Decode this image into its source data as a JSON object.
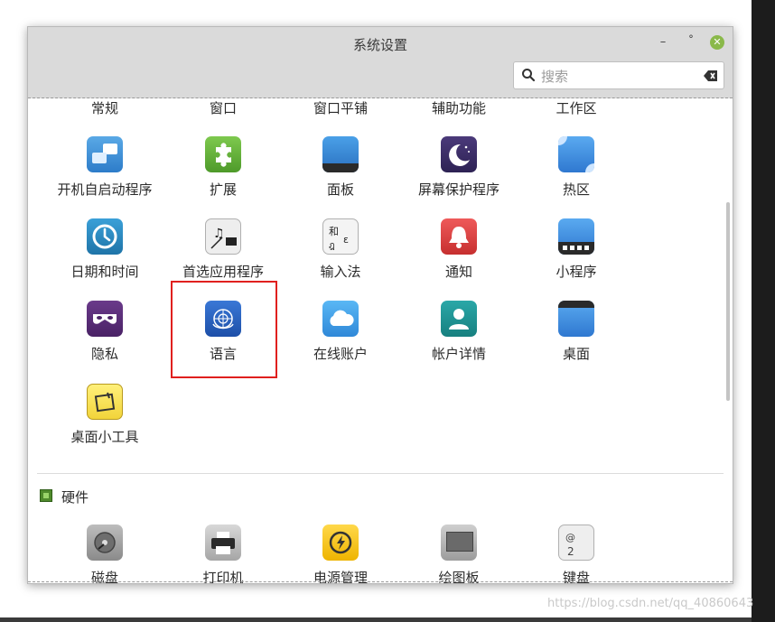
{
  "window": {
    "title": "系统设置",
    "controls": {
      "minimize": "–",
      "maximize": "˚",
      "close": "✕"
    }
  },
  "search": {
    "placeholder": "搜索",
    "value": ""
  },
  "top_row_labels": [
    "常规",
    "窗口",
    "窗口平铺",
    "辅助功能",
    "工作区"
  ],
  "preferences": {
    "row1": [
      {
        "label": "开机自启动程序",
        "icon": "startup-apps-icon"
      },
      {
        "label": "扩展",
        "icon": "extensions-puzzle-icon"
      },
      {
        "label": "面板",
        "icon": "panel-icon"
      },
      {
        "label": "屏幕保护程序",
        "icon": "screensaver-moon-icon"
      },
      {
        "label": "热区",
        "icon": "hot-corners-icon"
      }
    ],
    "row2": [
      {
        "label": "日期和时间",
        "icon": "clock-icon"
      },
      {
        "label": "首选应用程序",
        "icon": "preferred-apps-icon"
      },
      {
        "label": "输入法",
        "icon": "input-method-icon"
      },
      {
        "label": "通知",
        "icon": "notification-bell-icon"
      },
      {
        "label": "小程序",
        "icon": "applets-icon"
      }
    ],
    "row3": [
      {
        "label": "隐私",
        "icon": "privacy-mask-icon"
      },
      {
        "label": "语言",
        "icon": "language-globe-icon"
      },
      {
        "label": "在线账户",
        "icon": "online-accounts-cloud-icon"
      },
      {
        "label": "帐户详情",
        "icon": "account-details-user-icon"
      },
      {
        "label": "桌面",
        "icon": "desktop-icon"
      }
    ],
    "row4": [
      {
        "label": "桌面小工具",
        "icon": "desklets-note-icon"
      }
    ]
  },
  "hardware": {
    "heading": "硬件",
    "items": [
      {
        "label": "磁盘",
        "icon": "disks-icon"
      },
      {
        "label": "打印机",
        "icon": "printer-icon"
      },
      {
        "label": "电源管理",
        "icon": "power-management-icon"
      },
      {
        "label": "绘图板",
        "icon": "graphics-tablet-icon"
      },
      {
        "label": "键盘",
        "icon": "keyboard-icon"
      }
    ]
  },
  "watermark": "https://blog.csdn.net/qq_40860643",
  "colors": {
    "highlight": "#e0201e",
    "close_button": "#8ab94a",
    "header_bg": "#dadada"
  }
}
